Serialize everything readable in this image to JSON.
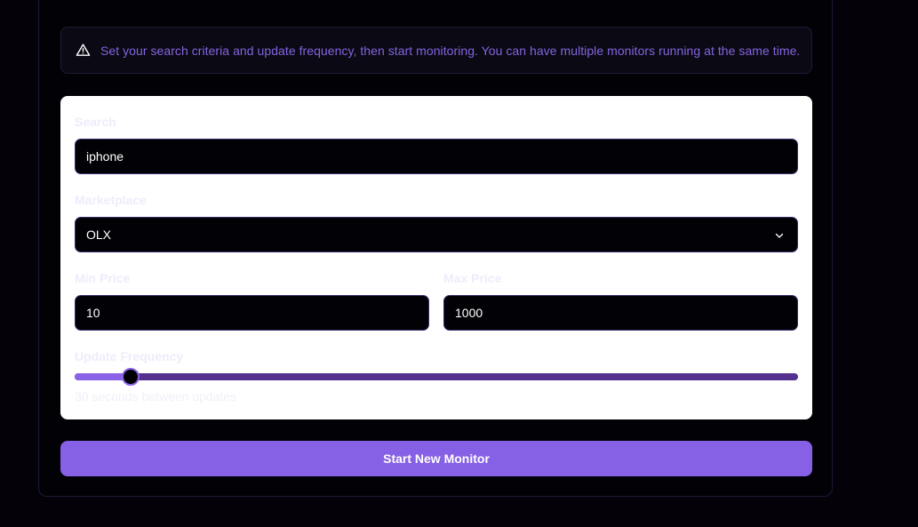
{
  "info_banner": {
    "icon": "warning-triangle-icon",
    "text": "Set your search criteria and update frequency, then start monitoring. You can have multiple monitors running at the same time."
  },
  "form": {
    "search": {
      "label": "Search",
      "value": "iphone"
    },
    "marketplace": {
      "label": "Marketplace",
      "value": "OLX",
      "icon": "chevron-down-icon"
    },
    "min_price": {
      "label": "Min Price",
      "value": "10"
    },
    "max_price": {
      "label": "Max Price",
      "value": "1000"
    },
    "update_frequency": {
      "label": "Update Frequency",
      "slider_level_fraction": 0.078,
      "helper_text": "30 seconds between updates"
    }
  },
  "actions": {
    "start_label": "Start New Monitor"
  },
  "colors": {
    "accent": "#8660e5",
    "banner_text": "#8564de",
    "background": "#040208"
  }
}
